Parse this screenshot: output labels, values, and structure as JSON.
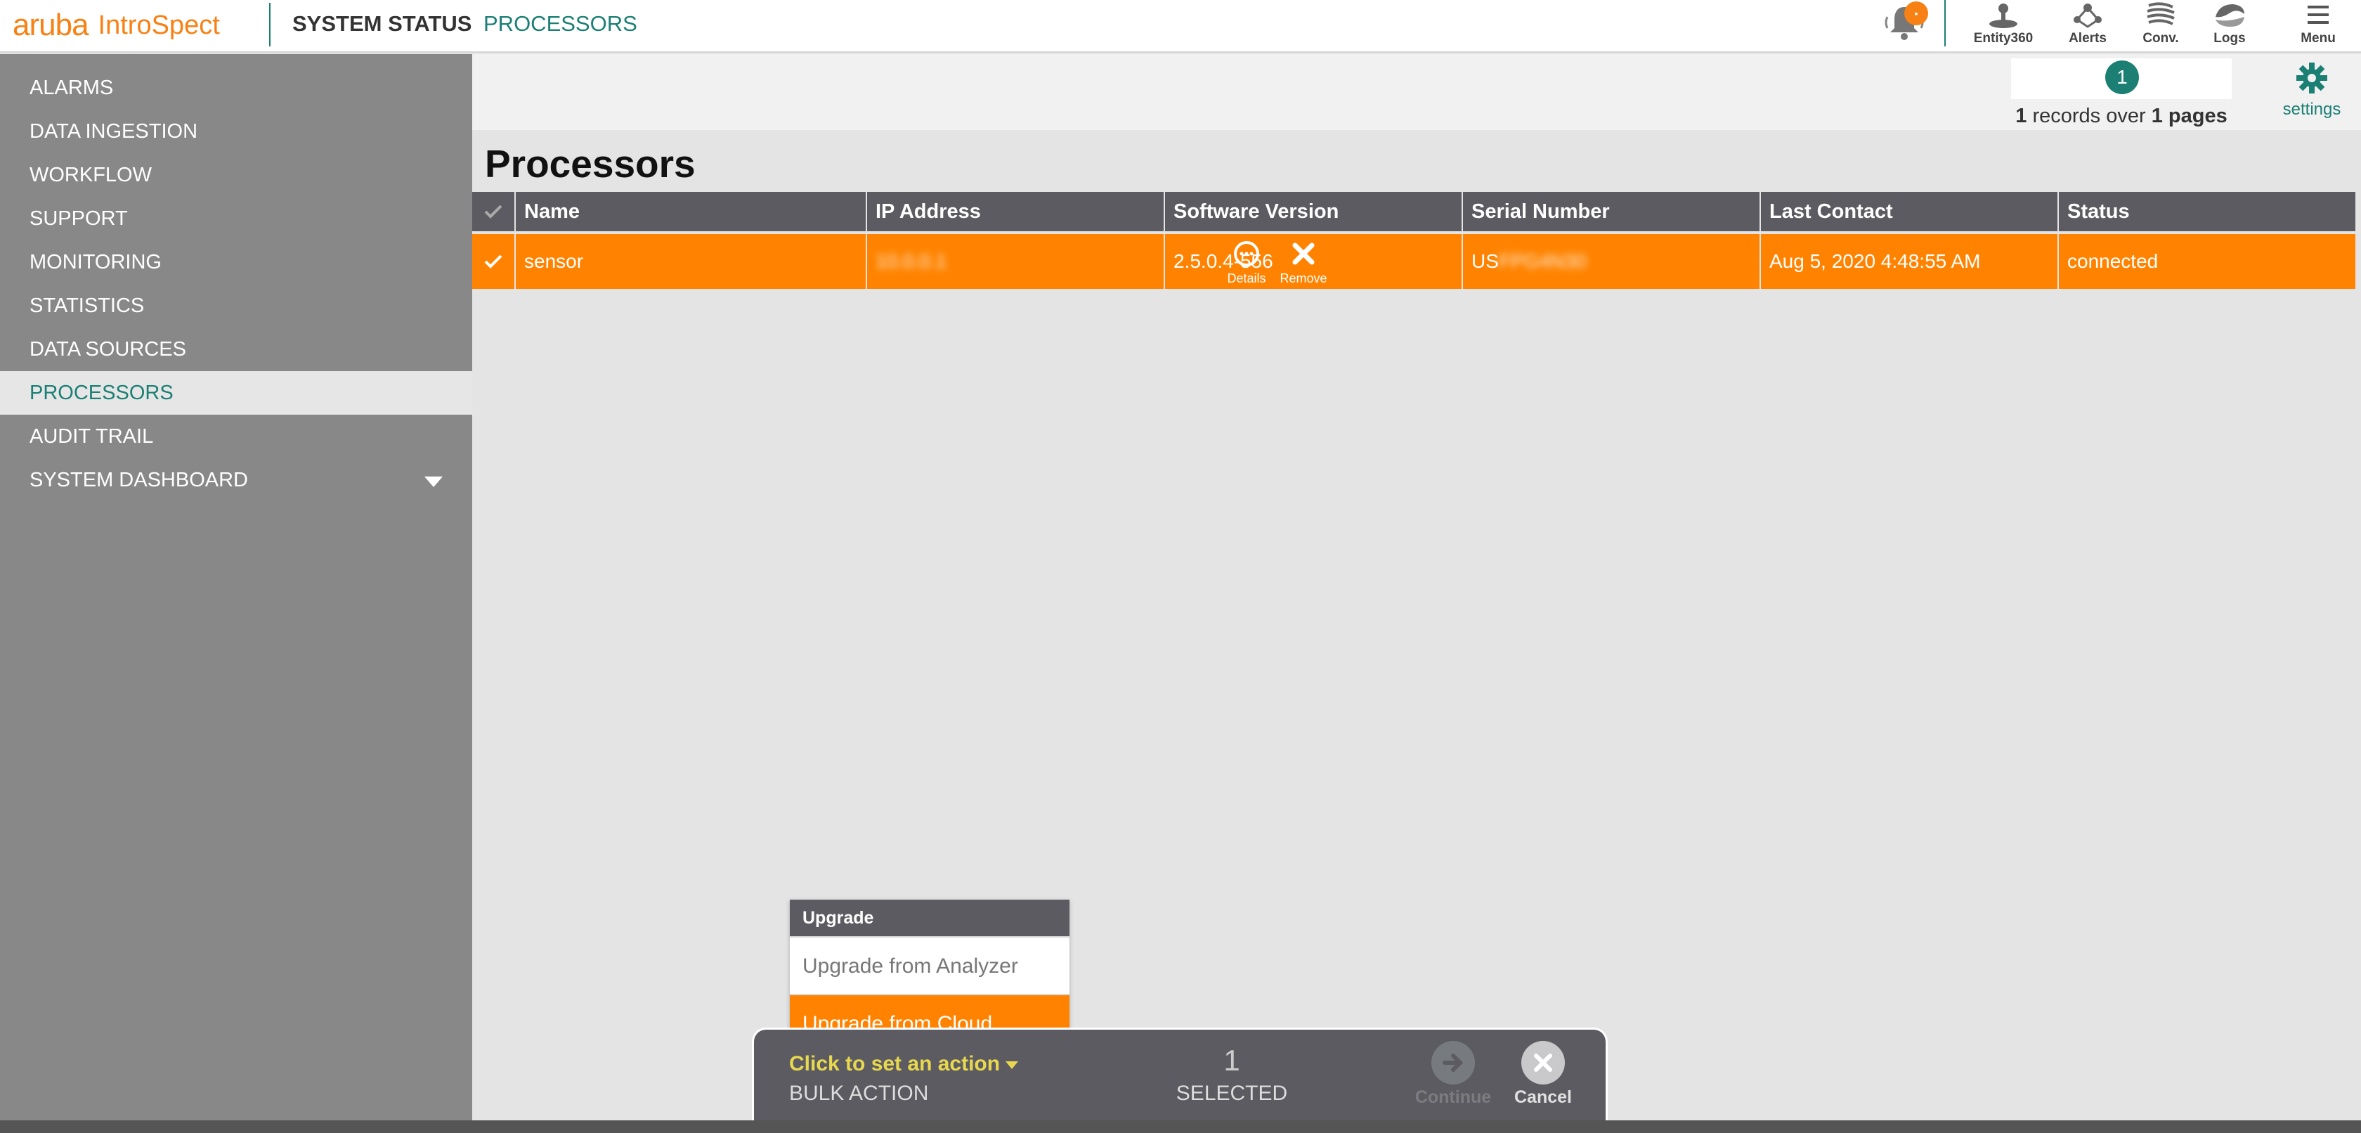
{
  "header": {
    "brand": "aruba",
    "product": "IntroSpect",
    "breadcrumb_section": "SYSTEM STATUS",
    "breadcrumb_page": "PROCESSORS",
    "nav_icons": [
      {
        "icon": "entity360-icon",
        "label": "Entity360"
      },
      {
        "icon": "alerts-icon",
        "label": "Alerts"
      },
      {
        "icon": "conversations-icon",
        "label": "Conv."
      },
      {
        "icon": "logs-icon",
        "label": "Logs"
      },
      {
        "icon": "menu-icon",
        "label": "Menu"
      }
    ]
  },
  "sidebar": {
    "items": [
      {
        "label": "ALARMS"
      },
      {
        "label": "DATA INGESTION"
      },
      {
        "label": "WORKFLOW"
      },
      {
        "label": "SUPPORT"
      },
      {
        "label": "MONITORING"
      },
      {
        "label": "STATISTICS"
      },
      {
        "label": "DATA SOURCES"
      },
      {
        "label": "PROCESSORS",
        "active": true
      },
      {
        "label": "AUDIT TRAIL"
      },
      {
        "label": "SYSTEM DASHBOARD",
        "has_caret": true
      }
    ]
  },
  "pager": {
    "current_page": "1",
    "records_count": "1",
    "records_word": "records over",
    "pages_count": "1",
    "pages_word": "pages"
  },
  "settings_label": "settings",
  "page_title": "Processors",
  "table": {
    "columns": [
      "Name",
      "IP Address",
      "Software Version",
      "Serial Number",
      "Last Contact",
      "Status"
    ],
    "rows": [
      {
        "name": "sensor",
        "details_label": "Details",
        "remove_label": "Remove",
        "ip": "10.0.0.1",
        "version": "2.5.0.4-556",
        "serial_prefix": "US",
        "serial_rest": "FPG4N30",
        "last_contact": "Aug 5, 2020 4:48:55 AM",
        "status": "connected"
      }
    ]
  },
  "dropdown": {
    "header": "Upgrade",
    "items": [
      "Upgrade from Analyzer",
      "Upgrade from Cloud"
    ]
  },
  "bulk": {
    "action_prompt": "Click to set an action",
    "action_label": "BULK ACTION",
    "selected_count": "1",
    "selected_label": "SELECTED",
    "continue_label": "Continue",
    "cancel_label": "Cancel"
  },
  "colors": {
    "brand_orange": "#f78114",
    "teal": "#1b7f74",
    "row_highlight": "#ff8300",
    "header_gray": "#5c5b61",
    "sidebar_gray": "#888888"
  }
}
